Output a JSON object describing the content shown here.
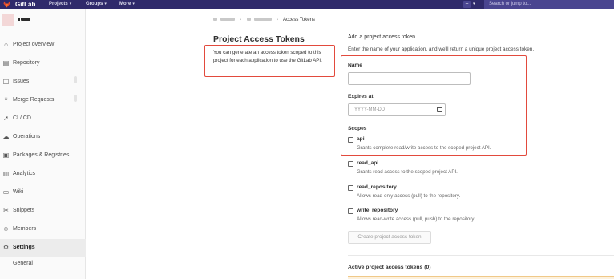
{
  "navbar": {
    "brand": "GitLab",
    "menus": [
      {
        "label": "Projects"
      },
      {
        "label": "Groups"
      },
      {
        "label": "More"
      }
    ],
    "search_placeholder": "Search or jump to..."
  },
  "sidebar": {
    "items": [
      {
        "label": "Project overview",
        "icon": "home-icon"
      },
      {
        "label": "Repository",
        "icon": "repository-icon"
      },
      {
        "label": "Issues",
        "icon": "issues-icon"
      },
      {
        "label": "Merge Requests",
        "icon": "merge-request-icon"
      },
      {
        "label": "CI / CD",
        "icon": "rocket-icon"
      },
      {
        "label": "Operations",
        "icon": "cloud-gear-icon"
      },
      {
        "label": "Packages & Registries",
        "icon": "package-icon"
      },
      {
        "label": "Analytics",
        "icon": "chart-icon"
      },
      {
        "label": "Wiki",
        "icon": "book-icon"
      },
      {
        "label": "Snippets",
        "icon": "scissors-icon"
      },
      {
        "label": "Members",
        "icon": "users-icon"
      },
      {
        "label": "Settings",
        "icon": "gear-icon"
      }
    ],
    "settings_sub": [
      "General"
    ]
  },
  "breadcrumb": {
    "current": "Access Tokens"
  },
  "page": {
    "title": "Project Access Tokens",
    "description": "You can generate an access token scoped to this project for each application to use the GitLab API."
  },
  "form": {
    "heading": "Add a project access token",
    "intro": "Enter the name of your application, and we'll return a unique project access token.",
    "name_label": "Name",
    "expires_label": "Expires at",
    "expires_placeholder": "YYYY-MM-DD",
    "scopes_label": "Scopes",
    "scopes": [
      {
        "name": "api",
        "description": "Grants complete read/write access to the scoped project API."
      },
      {
        "name": "read_api",
        "description": "Grants read access to the scoped project API."
      },
      {
        "name": "read_repository",
        "description": "Allows read-only access (pull) to the repository."
      },
      {
        "name": "write_repository",
        "description": "Allows read-write access (pull, push) to the repository."
      }
    ],
    "submit_label": "Create project access token"
  },
  "active_tokens": {
    "title": "Active project access tokens (0)"
  },
  "colors": {
    "navbar": "#2f2a6b",
    "highlight": "#e24a3d",
    "logo": "#e2492f"
  }
}
